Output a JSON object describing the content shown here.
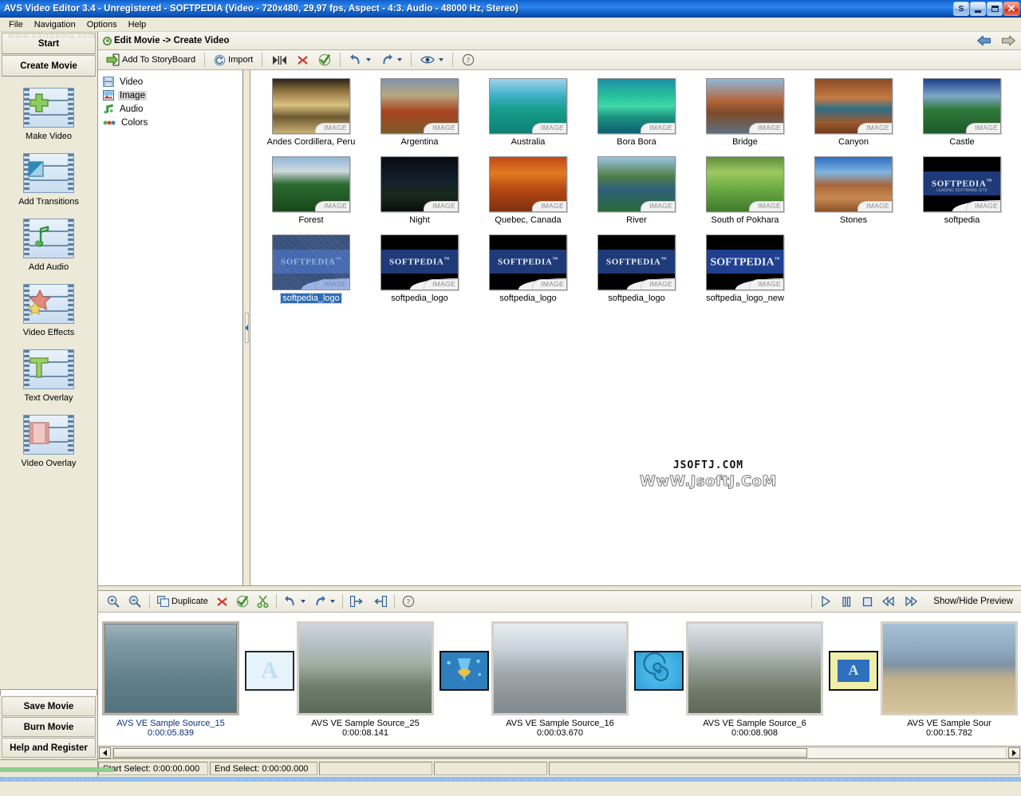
{
  "window": {
    "title": "AVS Video Editor 3.4 - Unregistered - SOFTPEDIA (Video - 720x480, 29,97 fps, Aspect - 4:3. Audio - 48000 Hz, Stereo)",
    "buttons": {
      "skin": "S",
      "minimize": "_",
      "restore": "❐",
      "close": "✕"
    }
  },
  "menubar": {
    "items": [
      "File",
      "Navigation",
      "Options",
      "Help"
    ]
  },
  "sidebar": {
    "start_label": "Start",
    "start_watermark": "www.softpedia.com",
    "create_movie_label": "Create Movie",
    "items": [
      {
        "label": "Make Video",
        "icon": "plus-filmstrip-icon"
      },
      {
        "label": "Add Transitions",
        "icon": "transition-filmstrip-icon"
      },
      {
        "label": "Add Audio",
        "icon": "music-note-filmstrip-icon"
      },
      {
        "label": "Video Effects",
        "icon": "stars-filmstrip-icon"
      },
      {
        "label": "Text Overlay",
        "icon": "letter-t-filmstrip-icon"
      },
      {
        "label": "Video Overlay",
        "icon": "overlay-filmstrip-icon"
      }
    ],
    "footer_buttons": [
      "Save Movie",
      "Burn Movie",
      "Help and Register"
    ]
  },
  "breadcrumb": {
    "text": "Edit Movie -> Create Video",
    "back": "back-arrow-icon",
    "forward": "forward-arrow-icon"
  },
  "toolbar_top": {
    "add_to_storyboard": "Add To StoryBoard",
    "import": "Import",
    "trim": "trim-icon",
    "delete": "delete-icon",
    "approve": "approve-icon",
    "undo": "undo-icon",
    "redo": "redo-icon",
    "preview": "eye-icon",
    "help": "help-icon"
  },
  "tree": {
    "items": [
      {
        "label": "Video",
        "icon": "film-icon",
        "selected": false
      },
      {
        "label": "Image",
        "icon": "picture-icon",
        "selected": true
      },
      {
        "label": "Audio",
        "icon": "music-note-icon",
        "selected": false
      },
      {
        "label": "Colors",
        "icon": "color-dots-icon",
        "selected": false
      }
    ]
  },
  "media": {
    "badge": "IMAGE",
    "items": [
      {
        "name": "Andes Cordillera, Peru",
        "selected": false,
        "art": "andes"
      },
      {
        "name": "Argentina",
        "selected": false,
        "art": "argentina"
      },
      {
        "name": "Australia",
        "selected": false,
        "art": "australia"
      },
      {
        "name": "Bora Bora",
        "selected": false,
        "art": "borabora"
      },
      {
        "name": "Bridge",
        "selected": false,
        "art": "bridge"
      },
      {
        "name": "Canyon",
        "selected": false,
        "art": "canyon"
      },
      {
        "name": "Castle",
        "selected": false,
        "art": "castle"
      },
      {
        "name": "Forest",
        "selected": false,
        "art": "forest"
      },
      {
        "name": "Night",
        "selected": false,
        "art": "night"
      },
      {
        "name": "Quebec, Canada",
        "selected": false,
        "art": "quebec"
      },
      {
        "name": "River",
        "selected": false,
        "art": "river"
      },
      {
        "name": "South of Pokhara",
        "selected": false,
        "art": "pokhara"
      },
      {
        "name": "Stones",
        "selected": false,
        "art": "stones"
      },
      {
        "name": "softpedia",
        "selected": false,
        "art": "logo1"
      },
      {
        "name": "softpedia_logo",
        "selected": true,
        "art": "logo2"
      },
      {
        "name": "softpedia_logo",
        "selected": false,
        "art": "logo3"
      },
      {
        "name": "softpedia_logo",
        "selected": false,
        "art": "logo4"
      },
      {
        "name": "softpedia_logo",
        "selected": false,
        "art": "logo5"
      },
      {
        "name": "softpedia_logo_new",
        "selected": false,
        "art": "logo6"
      }
    ],
    "watermark_line1": "JSOFTJ.COM",
    "watermark_line2": "WwW.JsoftJ.CoM"
  },
  "toolbar_bottom": {
    "zoom_in": "zoom-in-icon",
    "zoom_out": "zoom-out-icon",
    "duplicate": "Duplicate",
    "delete": "delete-icon",
    "approve": "approve-icon",
    "cut": "scissors-icon",
    "undo": "undo-icon",
    "redo": "redo-icon",
    "move_right": "move-right-icon",
    "move_left": "move-left-icon",
    "help": "help-icon",
    "play": "play-icon",
    "pause": "pause-icon",
    "stop": "stop-icon",
    "rewind": "rewind-icon",
    "forward": "fast-forward-icon",
    "show_hide_preview": "Show/Hide Preview"
  },
  "storyboard": {
    "clips": [
      {
        "name": "AVS VE Sample Source_15",
        "duration": "0:00:05.839",
        "selected": true,
        "art": "clip15"
      },
      {
        "name": "AVS VE Sample Source_25",
        "duration": "0:00:08.141",
        "selected": false,
        "art": "clip25"
      },
      {
        "name": "AVS VE Sample Source_16",
        "duration": "0:00:03.670",
        "selected": false,
        "art": "clip16"
      },
      {
        "name": "AVS VE Sample Source_6",
        "duration": "0:00:08.908",
        "selected": false,
        "art": "clip6"
      },
      {
        "name": "AVS VE Sample Sour",
        "duration": "0:00:15.782",
        "selected": false,
        "art": "clipbeach"
      }
    ],
    "transitions": [
      {
        "kind": "letter-a-white"
      },
      {
        "kind": "page-curl-blue"
      },
      {
        "kind": "spiral-blue"
      },
      {
        "kind": "letter-a-yellow"
      }
    ]
  },
  "statusbar": {
    "start_select": "Start Select: 0:00:00.000",
    "end_select": "End Select: 0:00:00.000",
    "cell3": "",
    "cell4": "",
    "cell5": ""
  }
}
